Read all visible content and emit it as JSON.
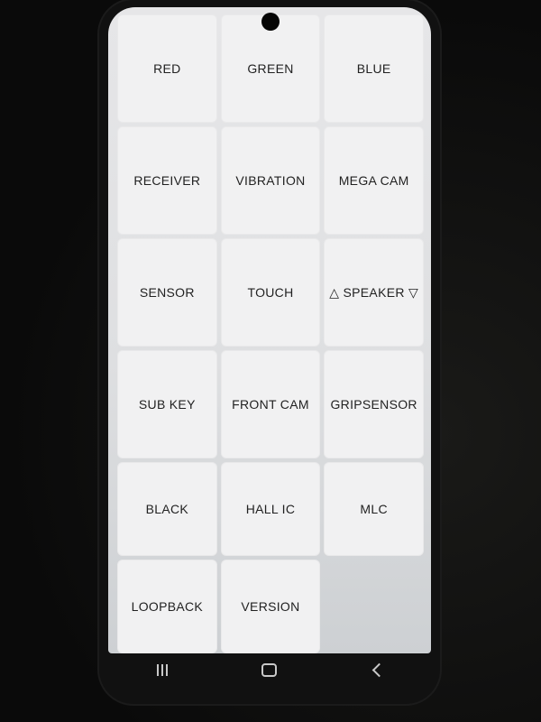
{
  "tiles": [
    {
      "label": "RED"
    },
    {
      "label": "GREEN"
    },
    {
      "label": "BLUE"
    },
    {
      "label": "RECEIVER"
    },
    {
      "label": "VIBRATION"
    },
    {
      "label": "MEGA CAM"
    },
    {
      "label": "SENSOR"
    },
    {
      "label": "TOUCH"
    },
    {
      "label": "△ SPEAKER ▽"
    },
    {
      "label": "SUB KEY"
    },
    {
      "label": "FRONT CAM"
    },
    {
      "label": "GRIPSENSOR"
    },
    {
      "label": "BLACK"
    },
    {
      "label": "HALL IC"
    },
    {
      "label": "MLC"
    },
    {
      "label": "LOOPBACK"
    },
    {
      "label": "VERSION"
    }
  ],
  "navbar": {
    "recents_icon": "recents-icon",
    "home_icon": "home-icon",
    "back_icon": "back-icon"
  }
}
